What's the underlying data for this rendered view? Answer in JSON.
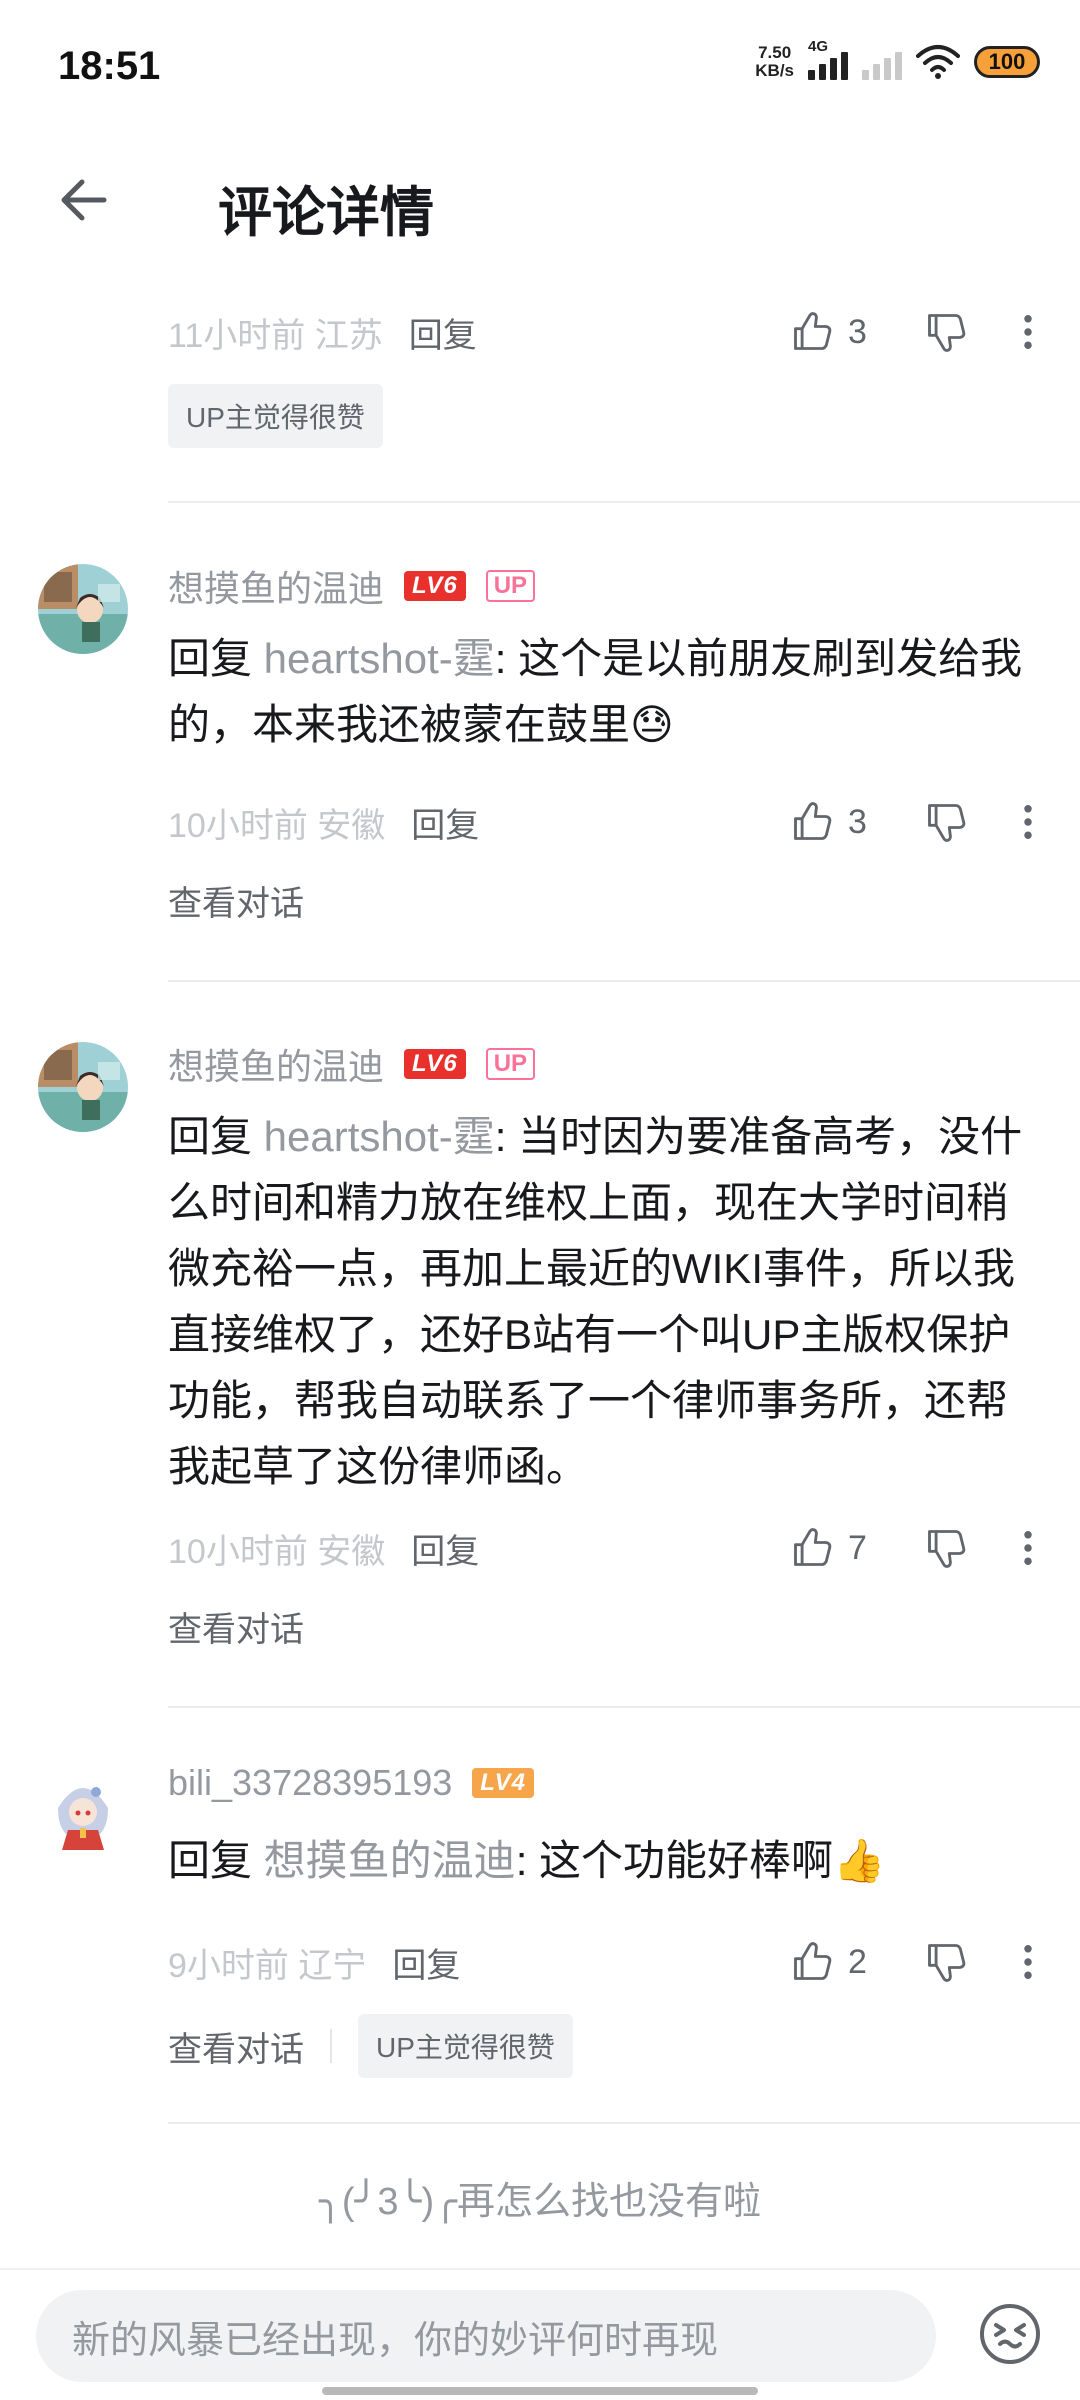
{
  "status": {
    "time": "18:51",
    "net_speed_value": "7.50",
    "net_speed_unit": "KB/s",
    "network_type": "4G",
    "battery": "100"
  },
  "header": {
    "title": "评论详情"
  },
  "comments": [
    {
      "time": "11小时前",
      "location": "江苏",
      "reply_label": "回复",
      "likes": "3",
      "tag": "UP主觉得很赞"
    },
    {
      "username": "想摸鱼的温迪",
      "level": "LV6",
      "up_badge": "UP",
      "reply_prefix": "回复 ",
      "mention": "heartshot-霆",
      "text": ": 这个是以前朋友刷到发给我的，本来我还被蒙在鼓里",
      "emoji": "😓",
      "time": "10小时前",
      "location": "安徽",
      "reply_label": "回复",
      "likes": "3",
      "view_conversation": "查看对话"
    },
    {
      "username": "想摸鱼的温迪",
      "level": "LV6",
      "up_badge": "UP",
      "reply_prefix": "回复 ",
      "mention": "heartshot-霆",
      "text": ": 当时因为要准备高考，没什么时间和精力放在维权上面，现在大学时间稍微充裕一点，再加上最近的WIKI事件，所以我直接维权了，还好B站有一个叫UP主版权保护功能，帮我自动联系了一个律师事务所，还帮我起草了这份律师函。",
      "time": "10小时前",
      "location": "安徽",
      "reply_label": "回复",
      "likes": "7",
      "view_conversation": "查看对话"
    },
    {
      "username": "bili_33728395193",
      "level": "LV4",
      "reply_prefix": "回复 ",
      "mention": "想摸鱼的温迪",
      "text": ": 这个功能好棒啊",
      "emoji": "👍",
      "time": "9小时前",
      "location": "辽宁",
      "reply_label": "回复",
      "likes": "2",
      "view_conversation": "查看对话",
      "tag": "UP主觉得很赞"
    }
  ],
  "footer_note": "╮(╯3╰)╭再怎么找也没有啦",
  "composer": {
    "placeholder": "新的风暴已经出现，你的妙评何时再现"
  },
  "icons": {
    "back": "arrow-left-icon",
    "like": "thumbs-up-icon",
    "dislike": "thumbs-down-icon",
    "more": "more-vertical-icon",
    "emoji": "emoji-face-icon"
  },
  "colors": {
    "secondary_text": "#9499a0",
    "level6": "#e8302d",
    "level4": "#f6a54a",
    "up_badge": "#fb7299"
  }
}
